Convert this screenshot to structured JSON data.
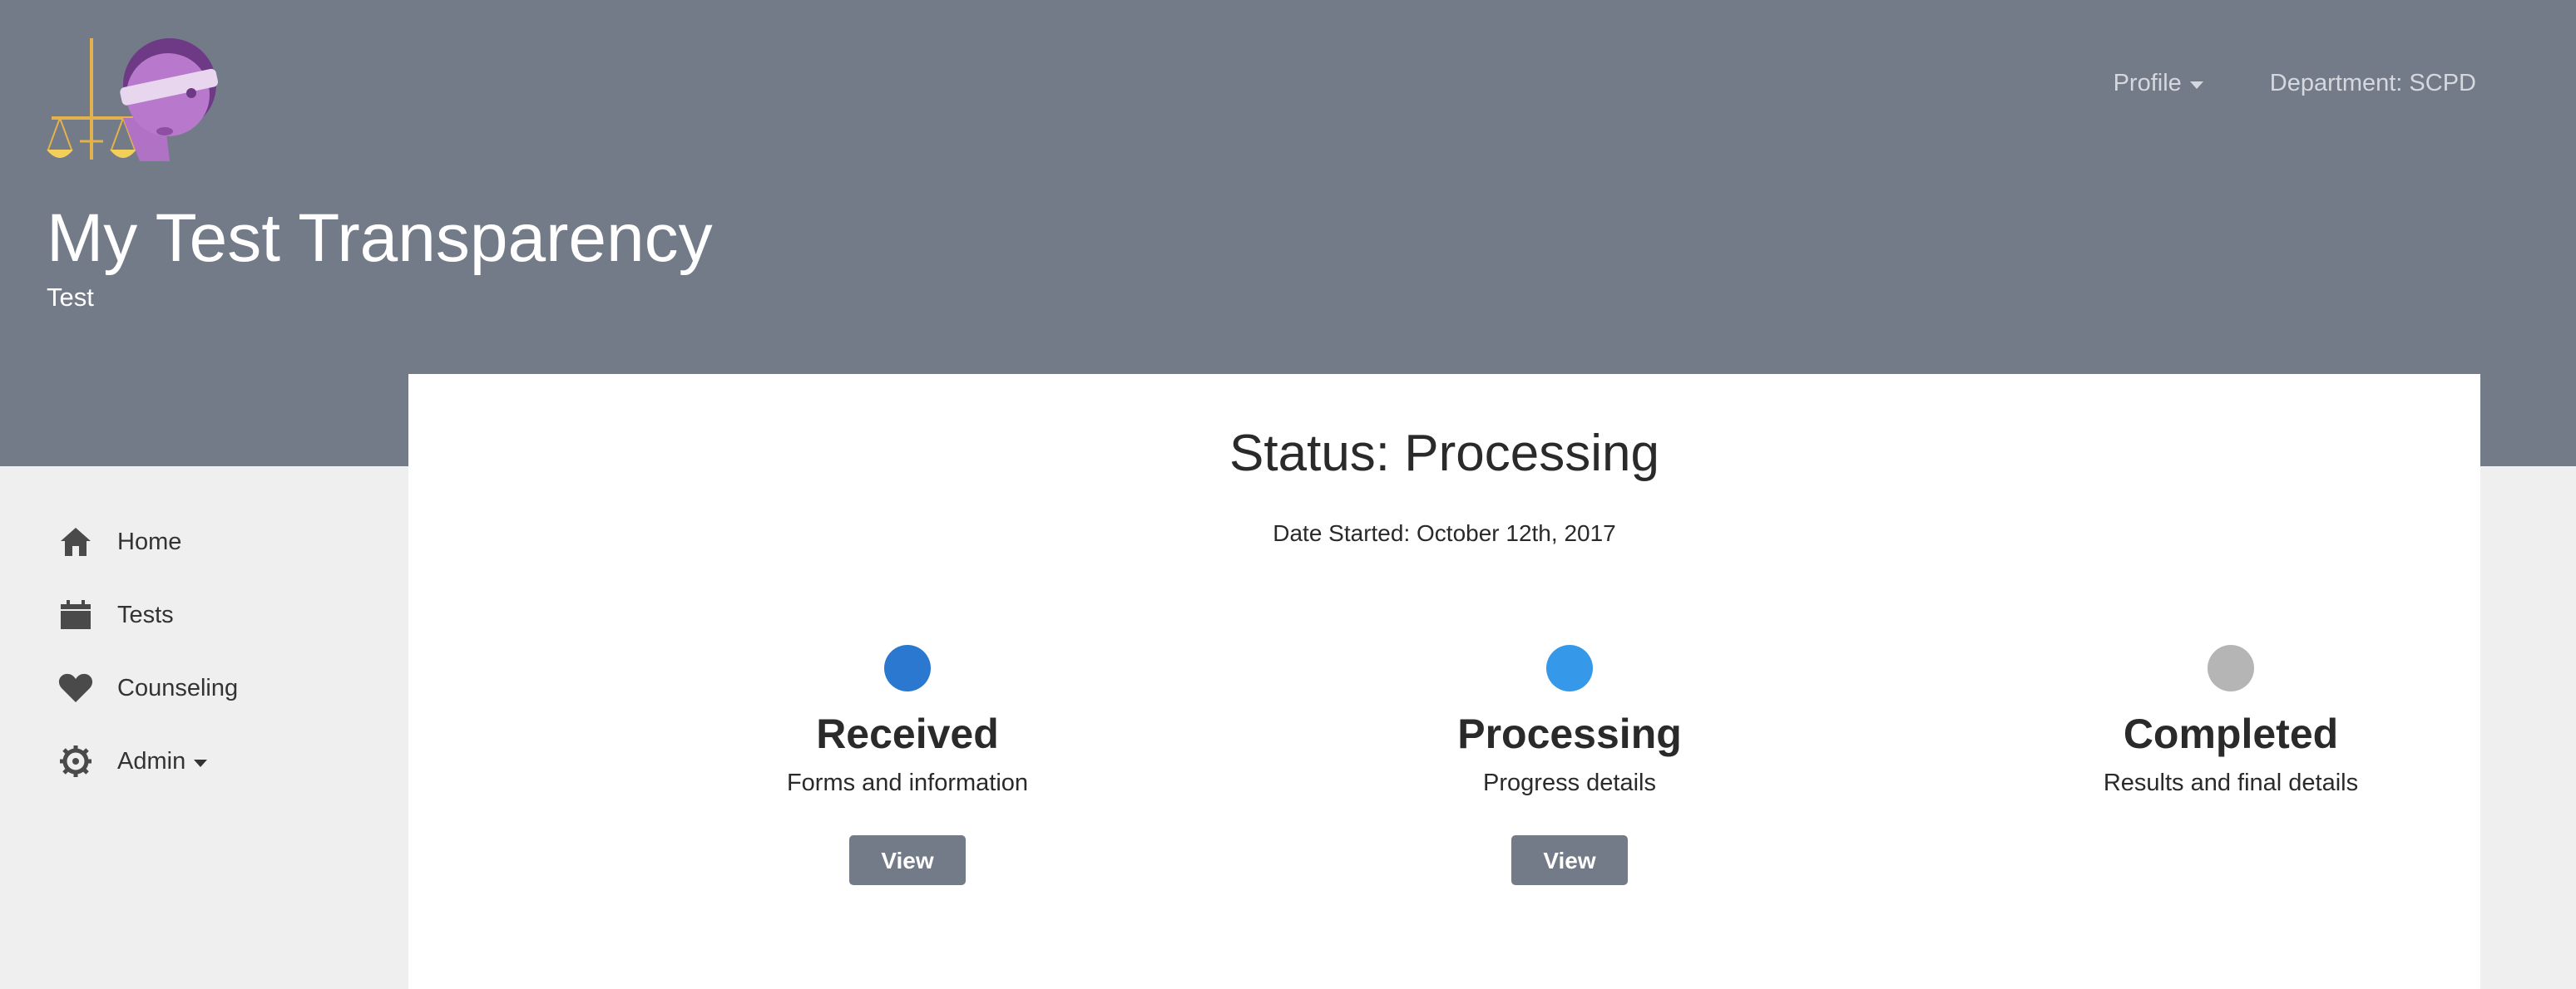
{
  "header": {
    "title": "My Test Transparency",
    "subtitle": "Test",
    "nav": {
      "profile_label": "Profile",
      "department_label": "Department: SCPD"
    }
  },
  "sidebar": {
    "items": [
      {
        "label": "Home",
        "icon": "home-icon"
      },
      {
        "label": "Tests",
        "icon": "calendar-icon"
      },
      {
        "label": "Counseling",
        "icon": "heart-icon"
      },
      {
        "label": "Admin",
        "icon": "gear-icon"
      }
    ]
  },
  "main": {
    "status_title": "Status: Processing",
    "date_started": "Date Started: October 12th, 2017",
    "stages": [
      {
        "name": "Received",
        "description": "Forms and information",
        "button": "View",
        "color": "#2b78d0"
      },
      {
        "name": "Processing",
        "description": "Progress details",
        "button": "View",
        "color": "#3598e8"
      },
      {
        "name": "Completed",
        "description": "Results and final details",
        "color": "#b5b5b5"
      }
    ]
  },
  "colors": {
    "header_bg": "#737a88",
    "page_bg": "#efefef",
    "button_bg": "#737a88"
  }
}
